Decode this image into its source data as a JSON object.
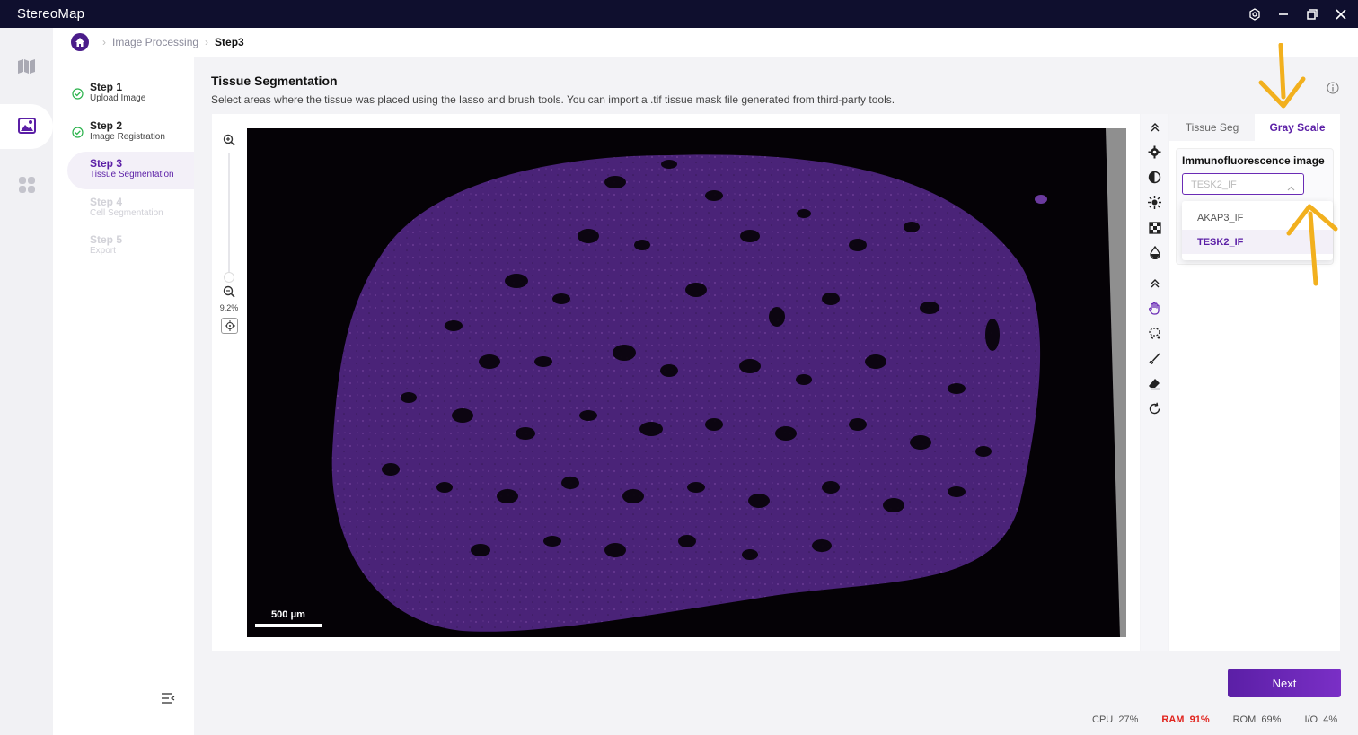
{
  "app": {
    "title": "StereoMap"
  },
  "colors": {
    "accent": "#5b1fa6",
    "titlebar": "#0f0f2e",
    "annotation_arrow": "#f2b01e",
    "ram_alert": "#e1241e"
  },
  "rail": {
    "items": [
      {
        "icon": "map-icon"
      },
      {
        "icon": "image-processing-icon",
        "active": true
      },
      {
        "icon": "apps-grid-icon"
      }
    ]
  },
  "breadcrumb": {
    "home_icon": "home-icon",
    "items": [
      "Image Processing",
      "Step3"
    ]
  },
  "steps": [
    {
      "title": "Step 1",
      "subtitle": "Upload Image",
      "state": "done"
    },
    {
      "title": "Step 2",
      "subtitle": "Image Registration",
      "state": "done"
    },
    {
      "title": "Step 3",
      "subtitle": "Tissue Segmentation",
      "state": "active"
    },
    {
      "title": "Step 4",
      "subtitle": "Cell Segmentation",
      "state": "disabled"
    },
    {
      "title": "Step 5",
      "subtitle": "Export",
      "state": "disabled"
    }
  ],
  "main": {
    "title": "Tissue Segmentation",
    "description": "Select areas where the tissue was placed using the lasso and brush tools. You can import a .tif tissue mask file generated from third-party tools."
  },
  "viewer": {
    "zoom_percent": "9.2%",
    "zoom_level_fraction": 0.0,
    "scale_bar_label": "500 μm"
  },
  "tools": [
    "collapse-up-icon",
    "settings-gear-icon",
    "contrast-icon",
    "brightness-icon",
    "checker-icon",
    "color-drop-icon",
    "collapse-up-icon",
    "hand-pan-icon",
    "lasso-icon",
    "brush-icon",
    "eraser-icon",
    "rotate-icon"
  ],
  "panel": {
    "tabs": [
      {
        "label": "Tissue Seg",
        "active": false
      },
      {
        "label": "Gray Scale",
        "active": true
      }
    ],
    "field_label": "Immunofluorescence image",
    "select_value": "TESK2_IF",
    "options": [
      {
        "label": "AKAP3_IF",
        "selected": false
      },
      {
        "label": "TESK2_IF",
        "selected": true
      }
    ]
  },
  "footer": {
    "next_label": "Next",
    "cpu_label": "CPU",
    "cpu_value": "27%",
    "ram_label": "RAM",
    "ram_value": "91%",
    "rom_label": "ROM",
    "rom_value": "69%",
    "io_label": "I/O",
    "io_value": "4%"
  }
}
